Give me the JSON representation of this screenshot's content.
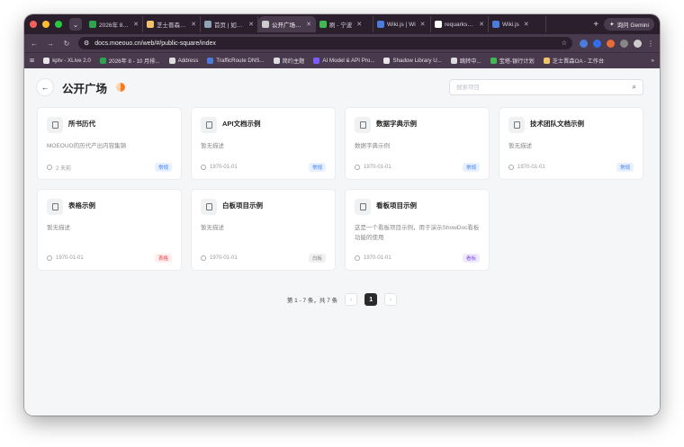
{
  "browser": {
    "tabs": [
      {
        "label": "2026年 8 - 1",
        "color": "#2ea44f"
      },
      {
        "label": "芝士晋森OA",
        "color": "#f0c36b"
      },
      {
        "label": "首页 | 如城片",
        "color": "#8fa3b8"
      },
      {
        "label": "公开广场 - S",
        "color": "#cccccc",
        "active": true
      },
      {
        "label": "刷 - 宁波",
        "color": "#3fb950"
      },
      {
        "label": "Wiki.js | Wi",
        "color": "#4a7cdc"
      },
      {
        "label": "requarks/wi",
        "color": "#ffffff"
      },
      {
        "label": "Wiki.js",
        "color": "#4a7cdc"
      }
    ],
    "gemini_label": "询问 Gemini",
    "url": "docs.moeouo.cn/web/#/public-square/index",
    "bookmarks": [
      {
        "label": "kptv - XLive 2.0",
        "color": "#e6e6e6"
      },
      {
        "label": "2026年 8 - 10 月排...",
        "color": "#2ea44f"
      },
      {
        "label": "Address",
        "color": "#dddddd"
      },
      {
        "label": "TrafficRoute DNS...",
        "color": "#4a7cdc"
      },
      {
        "label": "简约主题",
        "color": "#dddddd"
      },
      {
        "label": "AI Model & API Pro...",
        "color": "#7c5cff"
      },
      {
        "label": "Shadow Library U...",
        "color": "#e6e6e6"
      },
      {
        "label": "跳转中...",
        "color": "#dddddd"
      },
      {
        "label": "宝塔-银行计划",
        "color": "#3fb950"
      },
      {
        "label": "芝士晋森OA - 工作台",
        "color": "#f0c36b"
      }
    ],
    "bookmarks_more": "»"
  },
  "page": {
    "title": "公开广场",
    "search_placeholder": "搜索项目"
  },
  "cards": [
    {
      "title": "所书历代",
      "desc": "MOEOUO的历代产出内容集锦",
      "date": "2 天前",
      "badge": "常规",
      "badge_type": "normal",
      "icon": "doc-icon"
    },
    {
      "title": "API文档示例",
      "desc": "暂无描述",
      "date": "1970-01-01",
      "badge": "常规",
      "badge_type": "normal",
      "icon": "doc-icon"
    },
    {
      "title": "数据字典示例",
      "desc": "数据字典示例",
      "date": "1970-01-01",
      "badge": "常规",
      "badge_type": "normal",
      "icon": "doc-icon"
    },
    {
      "title": "技术团队文档示例",
      "desc": "暂无描述",
      "date": "1970-01-01",
      "badge": "常规",
      "badge_type": "normal",
      "icon": "doc-icon"
    },
    {
      "title": "表格示例",
      "desc": "暂无描述",
      "date": "1970-01-01",
      "badge": "表格",
      "badge_type": "table",
      "icon": "table-icon"
    },
    {
      "title": "白板项目示例",
      "desc": "暂无描述",
      "date": "1970-01-01",
      "badge": "白板",
      "badge_type": "whiteboard",
      "icon": "whiteboard-icon"
    },
    {
      "title": "看板项目示例",
      "desc": "这是一个看板项目示例，用于演示ShowDoc看板功能的使用",
      "date": "1970-01-01",
      "badge": "看板",
      "badge_type": "kanban",
      "icon": "kanban-icon"
    }
  ],
  "pagination": {
    "summary": "第 1 - 7 条，共 7 条",
    "current": "1",
    "prev": "‹",
    "next": "›"
  }
}
